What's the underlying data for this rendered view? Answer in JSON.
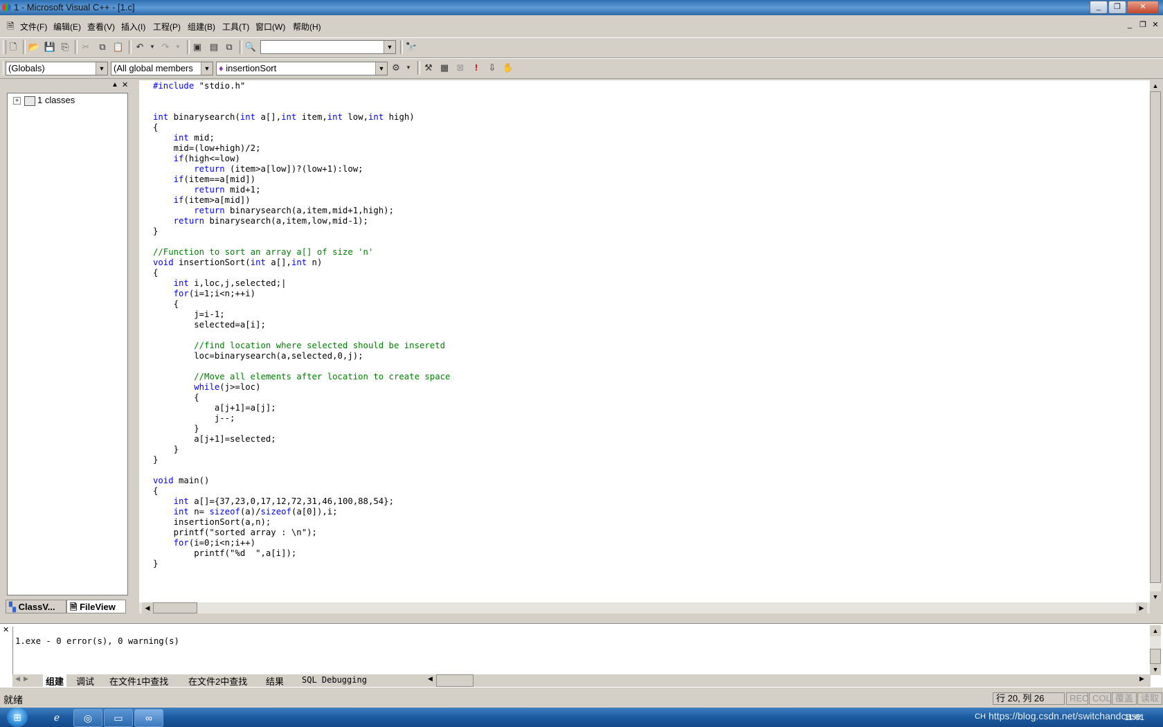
{
  "window": {
    "title": "1 - Microsoft Visual C++ - [1.c]",
    "min": "_",
    "restore": "❐",
    "close": "✕"
  },
  "menu": {
    "items": [
      "文件(F)",
      "编辑(E)",
      "查看(V)",
      "插入(I)",
      "工程(P)",
      "组建(B)",
      "工具(T)",
      "窗口(W)",
      "帮助(H)"
    ],
    "mdi_min": "_",
    "mdi_restore": "❐",
    "mdi_close": "✕"
  },
  "toolbar1": {
    "find_combo_value": ""
  },
  "toolbar2": {
    "scope_combo": "(Globals)",
    "members_combo": "(All global members",
    "function_combo": "insertionSort"
  },
  "workspace": {
    "tree_root": "1 classes",
    "tabs": [
      "ClassV...",
      "FileView"
    ]
  },
  "editor": {
    "lines": [
      [
        {
          "t": "#include",
          "c": "kw"
        },
        {
          "t": " \"stdio.h\""
        }
      ],
      [],
      [],
      [
        {
          "t": "int",
          "c": "kw"
        },
        {
          "t": " binarysearch("
        },
        {
          "t": "int",
          "c": "kw"
        },
        {
          "t": " a[],"
        },
        {
          "t": "int",
          "c": "kw"
        },
        {
          "t": " item,"
        },
        {
          "t": "int",
          "c": "kw"
        },
        {
          "t": " low,"
        },
        {
          "t": "int",
          "c": "kw"
        },
        {
          "t": " high)"
        }
      ],
      [
        {
          "t": "{"
        }
      ],
      [
        {
          "t": "    "
        },
        {
          "t": "int",
          "c": "kw"
        },
        {
          "t": " mid;"
        }
      ],
      [
        {
          "t": "    mid=(low+high)/2;"
        }
      ],
      [
        {
          "t": "    "
        },
        {
          "t": "if",
          "c": "kw"
        },
        {
          "t": "(high<=low)"
        }
      ],
      [
        {
          "t": "        "
        },
        {
          "t": "return",
          "c": "kw"
        },
        {
          "t": " (item>a[low])?(low+1):low;"
        }
      ],
      [
        {
          "t": "    "
        },
        {
          "t": "if",
          "c": "kw"
        },
        {
          "t": "(item==a[mid])"
        }
      ],
      [
        {
          "t": "        "
        },
        {
          "t": "return",
          "c": "kw"
        },
        {
          "t": " mid+1;"
        }
      ],
      [
        {
          "t": "    "
        },
        {
          "t": "if",
          "c": "kw"
        },
        {
          "t": "(item>a[mid])"
        }
      ],
      [
        {
          "t": "        "
        },
        {
          "t": "return",
          "c": "kw"
        },
        {
          "t": " binarysearch(a,item,mid+1,high);"
        }
      ],
      [
        {
          "t": "    "
        },
        {
          "t": "return",
          "c": "kw"
        },
        {
          "t": " binarysearch(a,item,low,mid-1);"
        }
      ],
      [
        {
          "t": "}"
        }
      ],
      [],
      [
        {
          "t": "//Function to sort an array a[] of size 'n'",
          "c": "cm"
        }
      ],
      [
        {
          "t": "void",
          "c": "kw"
        },
        {
          "t": " insertionSort("
        },
        {
          "t": "int",
          "c": "kw"
        },
        {
          "t": " a[],"
        },
        {
          "t": "int",
          "c": "kw"
        },
        {
          "t": " n)"
        }
      ],
      [
        {
          "t": "{"
        }
      ],
      [
        {
          "t": "    "
        },
        {
          "t": "int",
          "c": "kw"
        },
        {
          "t": " i,loc,j,selected;|"
        }
      ],
      [
        {
          "t": "    "
        },
        {
          "t": "for",
          "c": "kw"
        },
        {
          "t": "(i=1;i<n;++i)"
        }
      ],
      [
        {
          "t": "    {"
        }
      ],
      [
        {
          "t": "        j=i-1;"
        }
      ],
      [
        {
          "t": "        selected=a[i];"
        }
      ],
      [],
      [
        {
          "t": "        "
        },
        {
          "t": "//find location where selected should be inseretd",
          "c": "cm"
        }
      ],
      [
        {
          "t": "        loc=binarysearch(a,selected,0,j);"
        }
      ],
      [],
      [
        {
          "t": "        "
        },
        {
          "t": "//Move all elements after location to create space",
          "c": "cm"
        }
      ],
      [
        {
          "t": "        "
        },
        {
          "t": "while",
          "c": "kw"
        },
        {
          "t": "(j>=loc)"
        }
      ],
      [
        {
          "t": "        {"
        }
      ],
      [
        {
          "t": "            a[j+1]=a[j];"
        }
      ],
      [
        {
          "t": "            j--;"
        }
      ],
      [
        {
          "t": "        }"
        }
      ],
      [
        {
          "t": "        a[j+1]=selected;"
        }
      ],
      [
        {
          "t": "    }"
        }
      ],
      [
        {
          "t": "}"
        }
      ],
      [],
      [
        {
          "t": "void",
          "c": "kw"
        },
        {
          "t": " main()"
        }
      ],
      [
        {
          "t": "{"
        }
      ],
      [
        {
          "t": "    "
        },
        {
          "t": "int",
          "c": "kw"
        },
        {
          "t": " a[]={37,23,0,17,12,72,31,46,100,88,54};"
        }
      ],
      [
        {
          "t": "    "
        },
        {
          "t": "int",
          "c": "kw"
        },
        {
          "t": " n= "
        },
        {
          "t": "sizeof",
          "c": "kw"
        },
        {
          "t": "(a)/"
        },
        {
          "t": "sizeof",
          "c": "kw"
        },
        {
          "t": "(a[0]),i;"
        }
      ],
      [
        {
          "t": "    insertionSort(a,n);"
        }
      ],
      [
        {
          "t": "    printf(\"sorted array : \\n\");"
        }
      ],
      [
        {
          "t": "    "
        },
        {
          "t": "for",
          "c": "kw"
        },
        {
          "t": "(i=0;i<n;i++)"
        }
      ],
      [
        {
          "t": "        printf(\"%d  \",a[i]);"
        }
      ],
      [
        {
          "t": "}"
        }
      ]
    ]
  },
  "output": {
    "text": "1.exe - 0 error(s), 0 warning(s)",
    "tabs": [
      "组建",
      "调试",
      "在文件1中查找",
      "在文件2中查找",
      "结果",
      "SQL Debugging"
    ]
  },
  "status": {
    "ready": "就绪",
    "position": "行 20, 列 26",
    "rec": "REC",
    "col": "COL",
    "ovr": "覆盖",
    "read": "读取"
  },
  "taskbar": {
    "lang": "CH",
    "watermark": "https://blog.csdn.net/switchandcase",
    "time": "11:01"
  },
  "colors": {
    "keyword": "#0000ff",
    "comment": "#008000",
    "titlebar": "#2e6fb3",
    "taskbar": "#1c5aa0"
  }
}
